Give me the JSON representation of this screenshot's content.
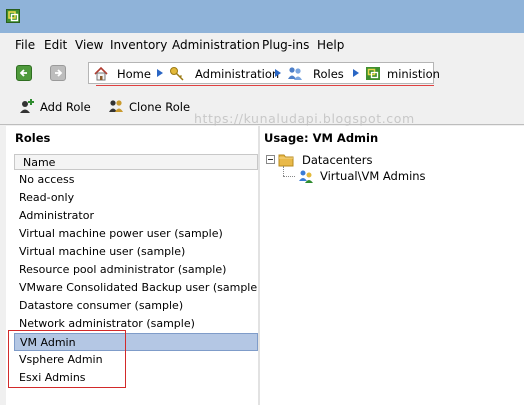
{
  "menubar": [
    "File",
    "Edit",
    "View",
    "Inventory",
    "Administration",
    "Plug-ins",
    "Help"
  ],
  "breadcrumb": {
    "home": "Home",
    "administration": "Administration",
    "roles": "Roles",
    "current": "ministion"
  },
  "toolbar": {
    "add_role": "Add Role",
    "clone_role": "Clone Role"
  },
  "watermark": "https://kunaludapi.blogspot.com",
  "roles_panel": {
    "title": "Roles",
    "column_header": "Name",
    "items": [
      "No access",
      "Read-only",
      "Administrator",
      "Virtual machine power user (sample)",
      "Virtual machine user (sample)",
      "Resource pool administrator (sample)",
      "VMware Consolidated Backup user (sample)",
      "Datastore consumer (sample)",
      "Network administrator (sample)",
      "VM Admin",
      "Vsphere Admin",
      "Esxi Admins"
    ],
    "selected": "VM Admin"
  },
  "usage_panel": {
    "title": "Usage: VM Admin",
    "tree_root": "Datacenters",
    "tree_child": "Virtual\\VM Admins"
  },
  "colors": {
    "selection": "#b4c7e4",
    "highlight_box": "#d22a2a",
    "breadcrumb_arrow": "#2a66c4"
  }
}
